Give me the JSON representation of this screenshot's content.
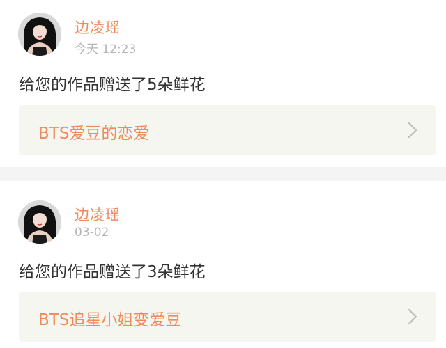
{
  "notifications": [
    {
      "username": "边凌瑶",
      "time": "今天 12:23",
      "message": "给您的作品赠送了5朵鲜花",
      "work_title": "BTS爱豆的恋爱",
      "avatar_icon": "user-avatar",
      "arrow_icon": "chevron-right-icon"
    },
    {
      "username": "边凌瑶",
      "time": "03-02",
      "message": "给您的作品赠送了3朵鲜花",
      "work_title": "BTS追星小姐变爱豆",
      "avatar_icon": "user-avatar",
      "arrow_icon": "chevron-right-icon"
    }
  ],
  "colors": {
    "accent": "#ef8a5a",
    "muted": "#b5b5b5",
    "text": "#333333",
    "link_bg": "#f6f6f1",
    "divider": "#f4f4f4"
  }
}
